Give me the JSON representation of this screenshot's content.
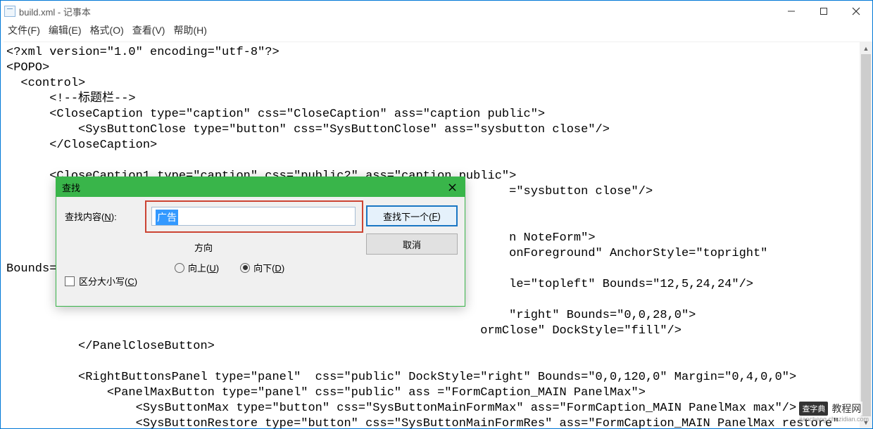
{
  "window": {
    "title": "build.xml - 记事本"
  },
  "menu": {
    "file": "文件(F)",
    "edit": "编辑(E)",
    "format": "格式(O)",
    "view": "查看(V)",
    "help": "帮助(H)"
  },
  "content": {
    "text": "<?xml version=\"1.0\" encoding=\"utf-8\"?>\n<POPO>\n  <control>\n      <!--标题栏-->\n      <CloseCaption type=\"caption\" css=\"CloseCaption\" ass=\"caption public\">\n          <SysButtonClose type=\"button\" css=\"SysButtonClose\" ass=\"sysbutton close\"/>\n      </CloseCaption>\n\n      <CloseCaption1 type=\"caption\" css=\"public2\" ass=\"caption public\">\n                                                                      =\"sysbutton close\"/>\n\n\n                                                                      n NoteForm\">\n                                                                      onForeground\" AnchorStyle=\"topright\"\nBounds=\"\n                                                                      le=\"topleft\" Bounds=\"12,5,24,24\"/>\n\n                                                                      \"right\" Bounds=\"0,0,28,0\">\n                                                                  ormClose\" DockStyle=\"fill\"/>\n          </PanelCloseButton>\n\n          <RightButtonsPanel type=\"panel\"  css=\"public\" DockStyle=\"right\" Bounds=\"0,0,120,0\" Margin=\"0,4,0,0\">\n              <PanelMaxButton type=\"panel\" css=\"public\" ass =\"FormCaption_MAIN PanelMax\">\n                  <SysButtonMax type=\"button\" css=\"SysButtonMainFormMax\" ass=\"FormCaption_MAIN PanelMax max\"/>\n                  <SysButtonRestore type=\"button\" css=\"SysButtonMainFormRes\" ass=\"FormCaption_MAIN PanelMax restore\"\nVisible=\"false\"/>"
  },
  "find": {
    "title": "查找",
    "content_label_prefix": "查找内容(",
    "content_label_key": "N",
    "content_label_suffix": "):",
    "input_value": "广告",
    "next_label": "查找下一个(",
    "next_key": "F",
    "next_suffix": ")",
    "cancel_label": "取消",
    "direction_label": "方向",
    "up_label": "向上(",
    "up_key": "U",
    "up_suffix": ")",
    "down_label": "向下(",
    "down_key": "D",
    "down_suffix": ")",
    "case_label": "区分大小写(",
    "case_key": "C",
    "case_suffix": ")",
    "direction_value": "down",
    "case_checked": false
  },
  "watermark": {
    "brand": "查字典",
    "suffix": "教程网",
    "url": "jiaocheng.chazidian.com"
  }
}
